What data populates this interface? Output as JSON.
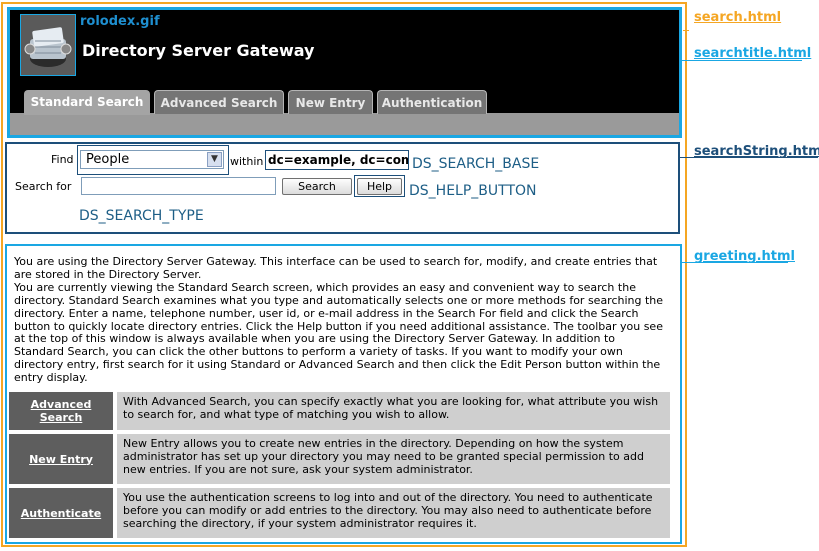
{
  "header": {
    "logo_label": "rolodex.gif",
    "app_title": "Directory Server Gateway",
    "tabs": [
      {
        "label": "Standard Search",
        "active": true
      },
      {
        "label": "Advanced Search",
        "active": false
      },
      {
        "label": "New Entry",
        "active": false
      },
      {
        "label": "Authentication",
        "active": false
      }
    ]
  },
  "search_form": {
    "find_label": "Find",
    "type_selected": "People",
    "within_label": "within",
    "search_base_value": "dc=example, dc=com",
    "search_for_label": "Search for",
    "search_input_value": "",
    "search_button": "Search",
    "help_button": "Help"
  },
  "annotations": {
    "search_base": "DS_SEARCH_BASE",
    "help_button": "DS_HELP_BUTTON",
    "search_type": "DS_SEARCH_TYPE"
  },
  "side_labels": {
    "search": "search.html",
    "searchtitle": "searchtitle.html",
    "searchstring": "searchString.html",
    "greeting": "greeting.html"
  },
  "greeting": {
    "intro": "You are using the Directory Server Gateway. This interface can be used to search for, modify, and create entries that are stored in the Directory Server.",
    "body": "You are currently viewing the Standard Search screen, which provides an easy and convenient way to search the directory. Standard Search examines what you type and automatically selects one or more methods for searching the directory. Enter a name, telephone number, user id, or e-mail address in the Search For field and click the Search button to quickly locate directory entries. Click the Help button if you need additional assistance. The toolbar you see at the top of this window is always available when you are using the Directory Server Gateway. In addition to Standard Search, you can click the other buttons to perform a variety of tasks. If you want to modify your own directory entry, first search for it using Standard or Advanced Search and then click the Edit Person button within the entry display.",
    "features": [
      {
        "label": "Advanced Search",
        "description": "With Advanced Search, you can specify exactly what you are looking for, what attribute you wish to search for, and what type of matching you wish to allow."
      },
      {
        "label": "New Entry",
        "description": "New Entry allows you to create new entries in the directory. Depending on how the system administrator has set up your directory you may need to be granted special permission to add new entries. If you are not sure, ask your system administrator."
      },
      {
        "label": "Authenticate",
        "description": "You use the authentication screens to log into and out of the directory. You need to authenticate before you can modify or add entries to the directory. You may also need to authenticate before searching the directory, if your system administrator requires it."
      }
    ]
  },
  "colors": {
    "orange_frame": "#f5a623",
    "light_blue_frame": "#1aa7e3",
    "navy_frame": "#1d4f7a"
  }
}
